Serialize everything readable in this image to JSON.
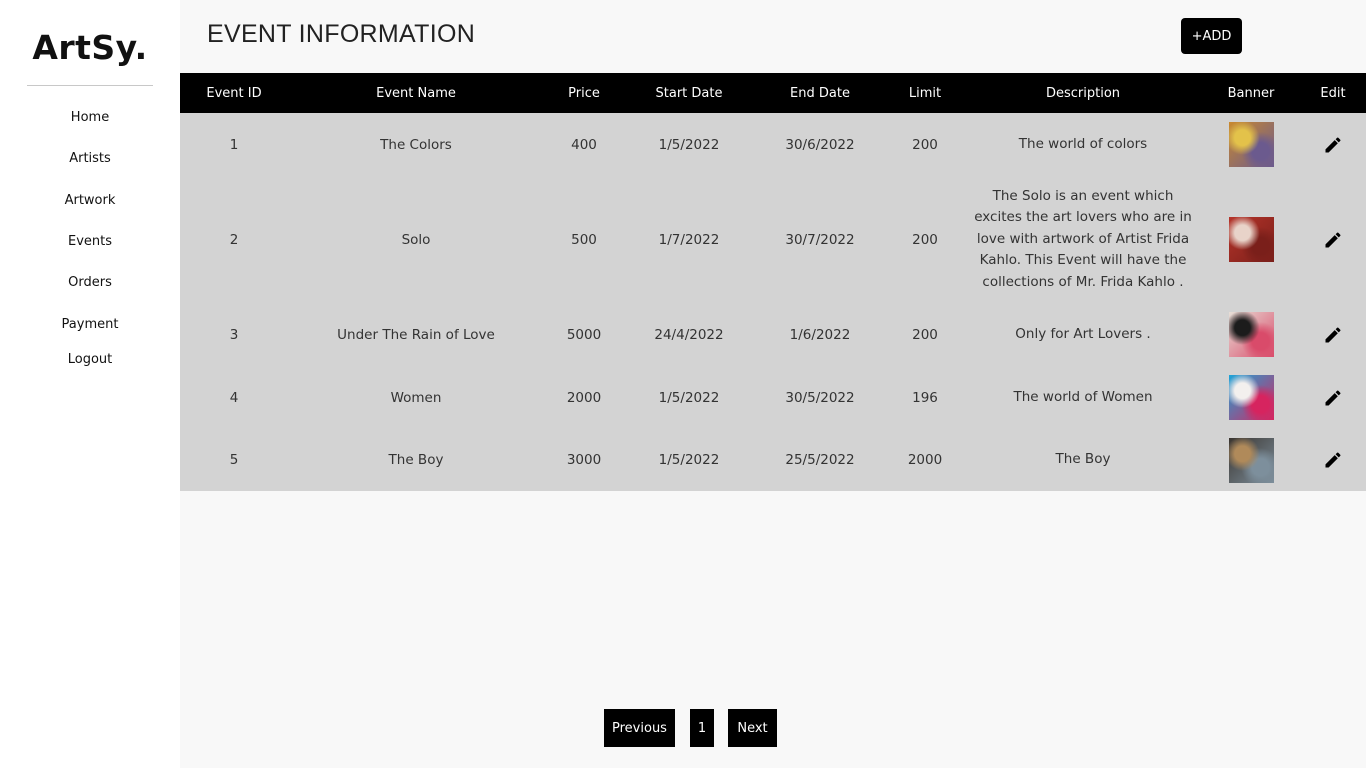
{
  "sidebar": {
    "logo": "ArtSy.",
    "items": [
      {
        "label": "Home"
      },
      {
        "label": "Artists"
      },
      {
        "label": "Artwork"
      },
      {
        "label": "Events"
      },
      {
        "label": "Orders"
      },
      {
        "label": "Payment"
      },
      {
        "label": "Logout"
      }
    ]
  },
  "header": {
    "title": "EVENT INFORMATION",
    "add_label": "+ADD"
  },
  "table": {
    "columns": [
      "Event ID",
      "Event Name",
      "Price",
      "Start Date",
      "End Date",
      "Limit",
      "Description",
      "Banner",
      "Edit"
    ],
    "rows": [
      {
        "id": "1",
        "name": "The Colors",
        "price": "400",
        "start": "1/5/2022",
        "end": "30/6/2022",
        "limit": "200",
        "description": "The world of colors",
        "banner_colors": [
          "#c9892f",
          "#e3c24a",
          "#6b5a8e"
        ]
      },
      {
        "id": "2",
        "name": "Solo",
        "price": "500",
        "start": "1/7/2022",
        "end": "30/7/2022",
        "limit": "200",
        "description": "The Solo is an event which excites the art lovers who are in love with artwork of Artist Frida Kahlo. This Event will have the collections of Mr. Frida Kahlo .",
        "banner_colors": [
          "#b5342a",
          "#e8d3c9",
          "#7a1f1a"
        ]
      },
      {
        "id": "3",
        "name": "Under The Rain of Love",
        "price": "5000",
        "start": "24/4/2022",
        "end": "1/6/2022",
        "limit": "200",
        "description": "Only for Art Lovers .",
        "banner_colors": [
          "#e7dfd7",
          "#1c1c1c",
          "#d94b6a"
        ]
      },
      {
        "id": "4",
        "name": "Women",
        "price": "2000",
        "start": "1/5/2022",
        "end": "30/5/2022",
        "limit": "196",
        "description": "The world of Women",
        "banner_colors": [
          "#1ca4d8",
          "#f3f0ee",
          "#d6245f"
        ]
      },
      {
        "id": "5",
        "name": "The Boy",
        "price": "3000",
        "start": "1/5/2022",
        "end": "25/5/2022",
        "limit": "2000",
        "description": "The Boy",
        "banner_colors": [
          "#3a3530",
          "#b08a5a",
          "#7d8f9c"
        ]
      }
    ]
  },
  "pagination": {
    "previous_label": "Previous",
    "current_page": "1",
    "next_label": "Next"
  },
  "icons": {
    "edit": "pencil-icon"
  }
}
